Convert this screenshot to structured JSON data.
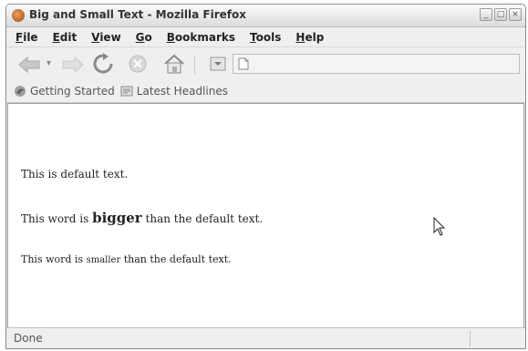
{
  "window": {
    "title": "Big and Small Text - Mozilla Firefox",
    "controls": {
      "minimize": "_",
      "maximize": "□",
      "close": "×"
    }
  },
  "menu": [
    {
      "accel": "F",
      "rest": "ile"
    },
    {
      "accel": "E",
      "rest": "dit"
    },
    {
      "accel": "V",
      "rest": "iew"
    },
    {
      "accel": "G",
      "rest": "o"
    },
    {
      "accel": "B",
      "rest": "ookmarks"
    },
    {
      "accel": "T",
      "rest": "ools"
    },
    {
      "accel": "H",
      "rest": "elp"
    }
  ],
  "toolbar": {
    "icons": [
      "back-icon",
      "forward-icon",
      "reload-icon",
      "stop-icon",
      "home-icon",
      "go-icon"
    ],
    "dropdown_mark": "▾",
    "url_value": ""
  },
  "bookmarks": {
    "getting_started": "Getting Started",
    "latest_headlines": "Latest Headlines"
  },
  "content": {
    "line1": "This is default text.",
    "line2_before": "This word is ",
    "line2_big": "bigger",
    "line2_after": " than the default text.",
    "line3_before": "This word is ",
    "line3_small": "smaller",
    "line3_after": " than the default text."
  },
  "status": {
    "text": "Done"
  }
}
